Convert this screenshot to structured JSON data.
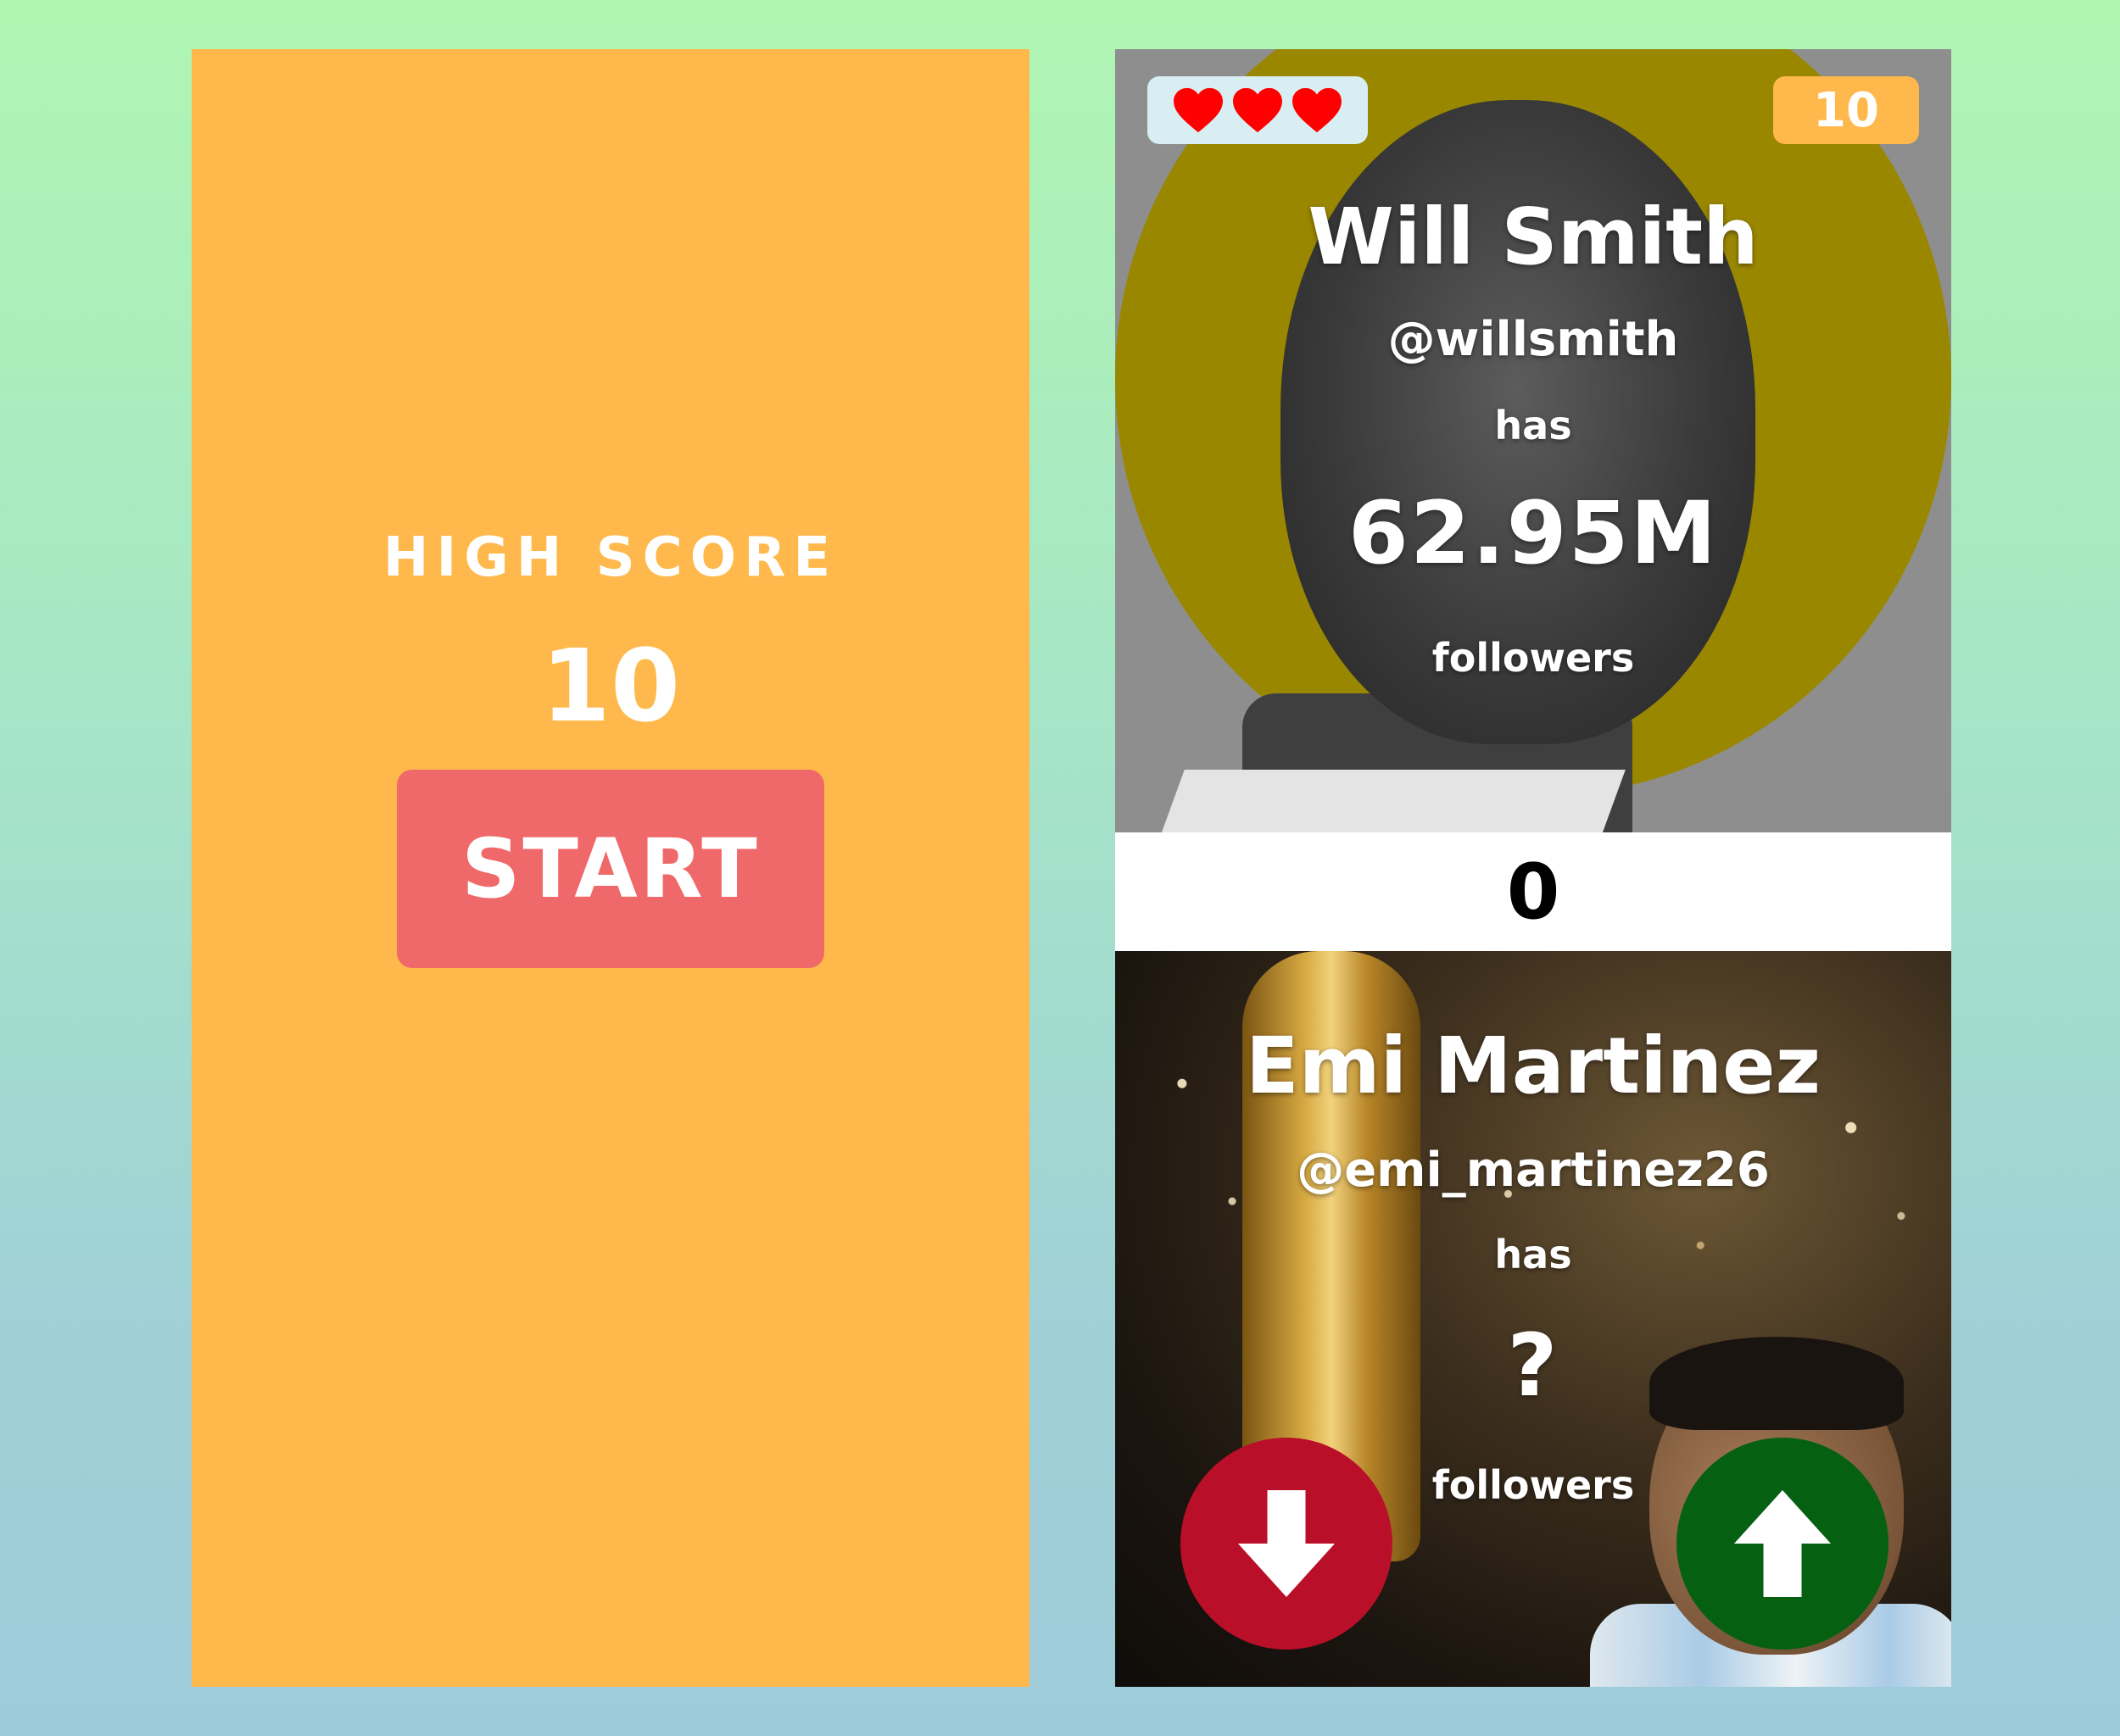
{
  "start_panel": {
    "high_score_label": "HIGH SCORE",
    "high_score_value": "10",
    "start_label": "START"
  },
  "game": {
    "lives": {
      "count": 3,
      "icon": "heart-icon",
      "color": "#ff0000"
    },
    "score": "10",
    "streak": "0",
    "top_card": {
      "name": "Will Smith",
      "handle": "@willsmith",
      "has_label": "has",
      "count": "62.95M",
      "followers_label": "followers"
    },
    "bottom_card": {
      "name": "Emi Martinez",
      "handle": "@emi_martinez26",
      "has_label": "has",
      "count": "?",
      "followers_label": "followers"
    },
    "buttons": {
      "lower": {
        "icon": "arrow-down-icon",
        "color": "#ba0f29"
      },
      "higher": {
        "icon": "arrow-up-icon",
        "color": "#056012"
      }
    }
  },
  "colors": {
    "panel_orange": "#ffb84c",
    "start_button": "#f0696a"
  }
}
